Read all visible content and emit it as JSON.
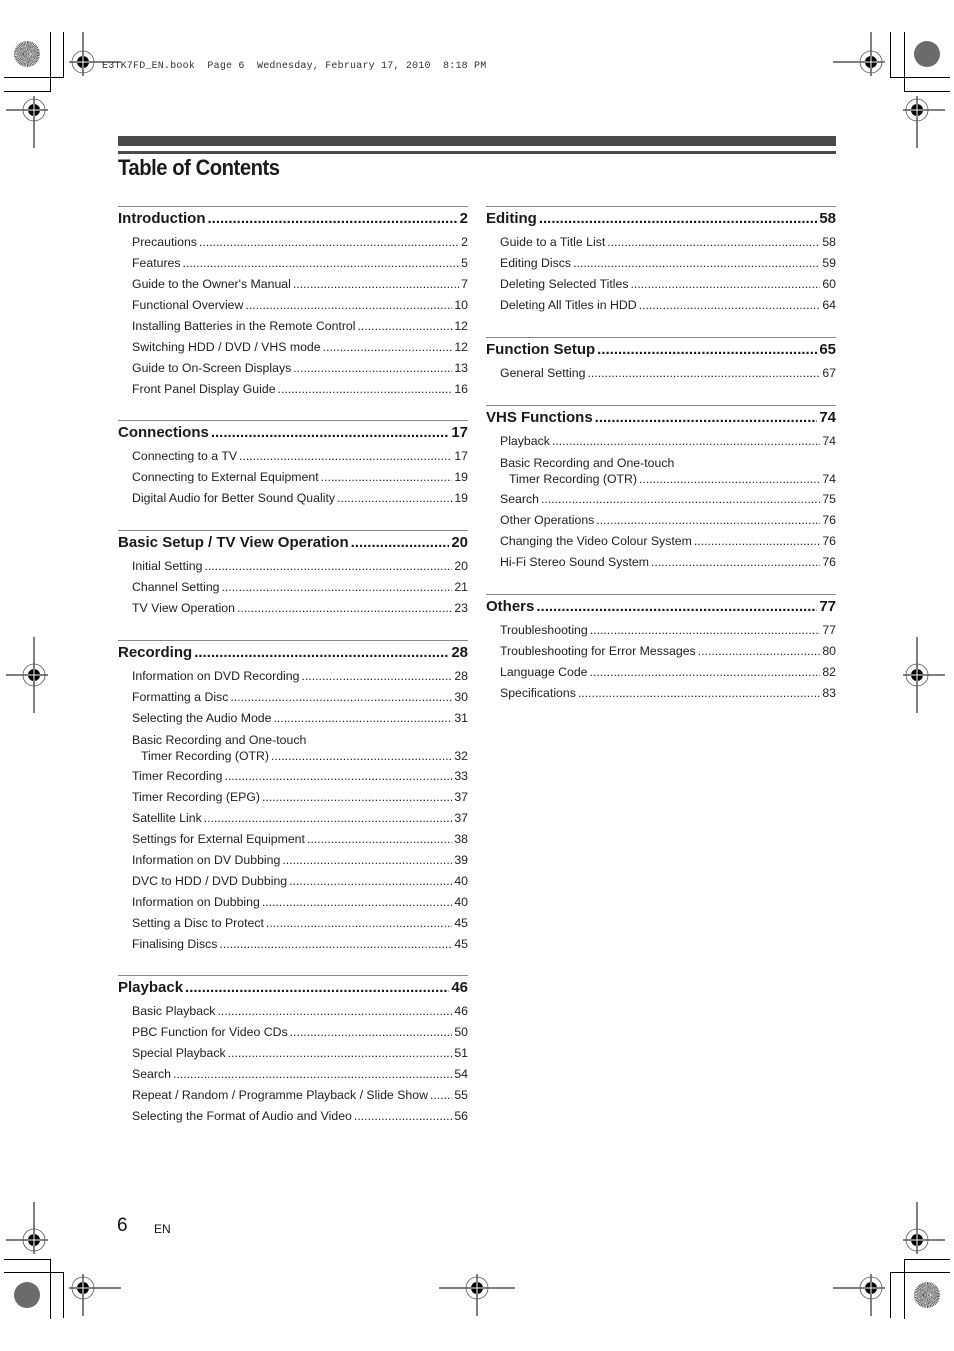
{
  "print_header": "E3TK7FD_EN.book  Page 6  Wednesday, February 17, 2010  8:18 PM",
  "title": "Table of Contents",
  "left_column": [
    {
      "title": "Introduction",
      "page": "2",
      "items": [
        {
          "label": "Precautions",
          "page": "2"
        },
        {
          "label": "Features",
          "page": "5"
        },
        {
          "label": "Guide to the Owner's Manual",
          "page": "7"
        },
        {
          "label": "Functional Overview",
          "page": "10"
        },
        {
          "label": "Installing Batteries in the Remote Control",
          "page": "12"
        },
        {
          "label": "Switching HDD / DVD / VHS mode",
          "page": "12"
        },
        {
          "label": "Guide to On-Screen Displays",
          "page": "13"
        },
        {
          "label": "Front Panel Display Guide",
          "page": "16"
        }
      ]
    },
    {
      "title": "Connections",
      "page": "17",
      "items": [
        {
          "label": "Connecting to a TV",
          "page": "17"
        },
        {
          "label": "Connecting to External Equipment",
          "page": "19"
        },
        {
          "label": "Digital Audio for Better Sound Quality",
          "page": "19"
        }
      ]
    },
    {
      "title": "Basic Setup / TV View Operation",
      "page": "20",
      "items": [
        {
          "label": "Initial Setting",
          "page": "20"
        },
        {
          "label": "Channel Setting",
          "page": "21"
        },
        {
          "label": "TV View Operation",
          "page": "23"
        }
      ]
    },
    {
      "title": "Recording",
      "page": "28",
      "items": [
        {
          "label": "Information on DVD Recording",
          "page": "28"
        },
        {
          "label": "Formatting a Disc",
          "page": "30"
        },
        {
          "label": "Selecting the Audio Mode",
          "page": "31"
        },
        {
          "label": "Basic Recording and One-touch",
          "label2": "Timer Recording (OTR)",
          "page": "32"
        },
        {
          "label": "Timer Recording",
          "page": "33"
        },
        {
          "label": "Timer Recording (EPG)",
          "page": "37"
        },
        {
          "label": "Satellite Link",
          "page": "37"
        },
        {
          "label": "Settings for External Equipment",
          "page": "38"
        },
        {
          "label": "Information on DV Dubbing",
          "page": "39"
        },
        {
          "label": "DVC to HDD / DVD Dubbing",
          "page": "40"
        },
        {
          "label": "Information on Dubbing",
          "page": "40"
        },
        {
          "label": "Setting a Disc to Protect",
          "page": "45"
        },
        {
          "label": "Finalising Discs",
          "page": "45"
        }
      ]
    },
    {
      "title": "Playback",
      "page": "46",
      "items": [
        {
          "label": "Basic Playback",
          "page": "46"
        },
        {
          "label": "PBC Function for Video CDs",
          "page": "50"
        },
        {
          "label": "Special Playback",
          "page": "51"
        },
        {
          "label": "Search",
          "page": "54"
        },
        {
          "label": "Repeat / Random / Programme Playback / Slide Show",
          "page": "55"
        },
        {
          "label": "Selecting the Format of Audio and Video",
          "page": "56"
        }
      ]
    }
  ],
  "right_column": [
    {
      "title": "Editing",
      "page": "58",
      "items": [
        {
          "label": "Guide to a Title List",
          "page": "58"
        },
        {
          "label": "Editing Discs",
          "page": "59"
        },
        {
          "label": "Deleting Selected Titles",
          "page": "60"
        },
        {
          "label": "Deleting All Titles in HDD",
          "page": "64"
        }
      ]
    },
    {
      "title": "Function Setup",
      "page": "65",
      "items": [
        {
          "label": "General Setting",
          "page": "67"
        }
      ]
    },
    {
      "title": "VHS Functions",
      "page": "74",
      "items": [
        {
          "label": "Playback",
          "page": "74"
        },
        {
          "label": "Basic Recording and One-touch",
          "label2": "Timer Recording (OTR)",
          "page": "74"
        },
        {
          "label": "Search",
          "page": "75"
        },
        {
          "label": "Other Operations",
          "page": "76"
        },
        {
          "label": "Changing the Video Colour System",
          "page": "76"
        },
        {
          "label": "Hi-Fi Stereo Sound System",
          "page": "76"
        }
      ]
    },
    {
      "title": "Others",
      "page": "77",
      "items": [
        {
          "label": "Troubleshooting",
          "page": "77"
        },
        {
          "label": "Troubleshooting for Error Messages",
          "page": "80"
        },
        {
          "label": "Language Code",
          "page": "82"
        },
        {
          "label": "Specifications",
          "page": "83"
        }
      ]
    }
  ],
  "footer": {
    "page_number": "6",
    "language": "EN"
  }
}
